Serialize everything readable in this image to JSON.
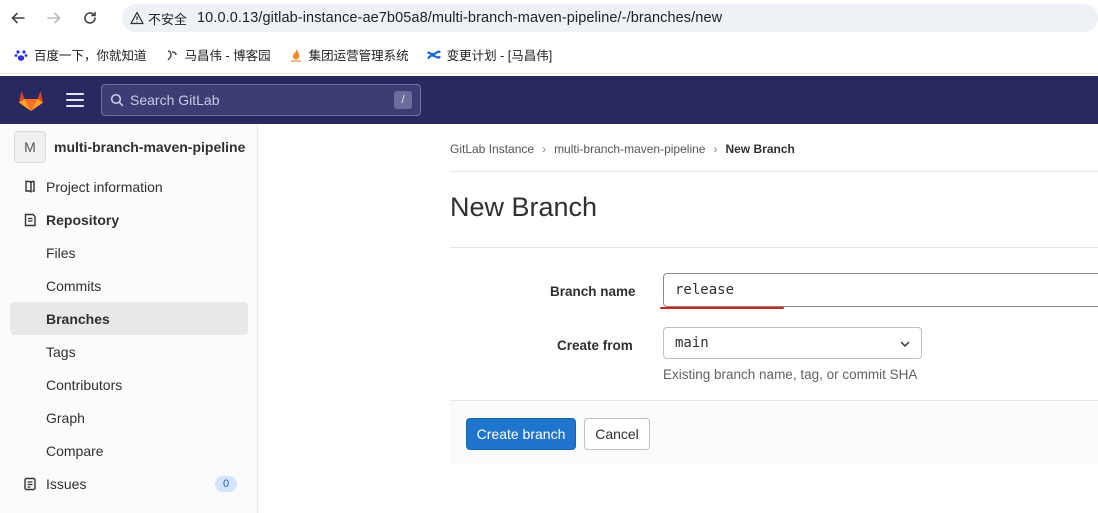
{
  "browser": {
    "insecure_label": "不安全",
    "url": "10.0.0.13/gitlab-instance-ae7b05a8/multi-branch-maven-pipeline/-/branches/new",
    "bookmarks": [
      {
        "label": "百度一下，你就知道",
        "icon": "baidu-paw-icon",
        "color": "#2932e1"
      },
      {
        "label": "马昌伟 - 博客园",
        "icon": "cnblogs-icon",
        "color": "#444444"
      },
      {
        "label": "集团运营管理系统",
        "icon": "flame-icon",
        "color": "#f28c28"
      },
      {
        "label": "变更计划 - [马昌伟]",
        "icon": "confluence-icon",
        "color": "#1868db"
      }
    ]
  },
  "topbar": {
    "search_placeholder": "Search GitLab",
    "search_shortcut": "/"
  },
  "sidebar": {
    "avatar_letter": "M",
    "project_name": "multi-branch-maven-pipeline",
    "project_information": "Project information",
    "repository": "Repository",
    "items": [
      "Files",
      "Commits",
      "Branches",
      "Tags",
      "Contributors",
      "Graph",
      "Compare"
    ],
    "issues_label": "Issues",
    "issues_count": "0"
  },
  "breadcrumb": [
    "GitLab Instance",
    "multi-branch-maven-pipeline",
    "New Branch"
  ],
  "page_title": "New Branch",
  "form": {
    "branch_name_label": "Branch name",
    "branch_name_value": "release",
    "create_from_label": "Create from",
    "create_from_value": "main",
    "create_from_help": "Existing branch name, tag, or commit SHA",
    "create_button": "Create branch",
    "cancel_button": "Cancel"
  },
  "colors": {
    "topbar": "#292961",
    "primary": "#1f75cb",
    "annotation": "#d42121"
  }
}
